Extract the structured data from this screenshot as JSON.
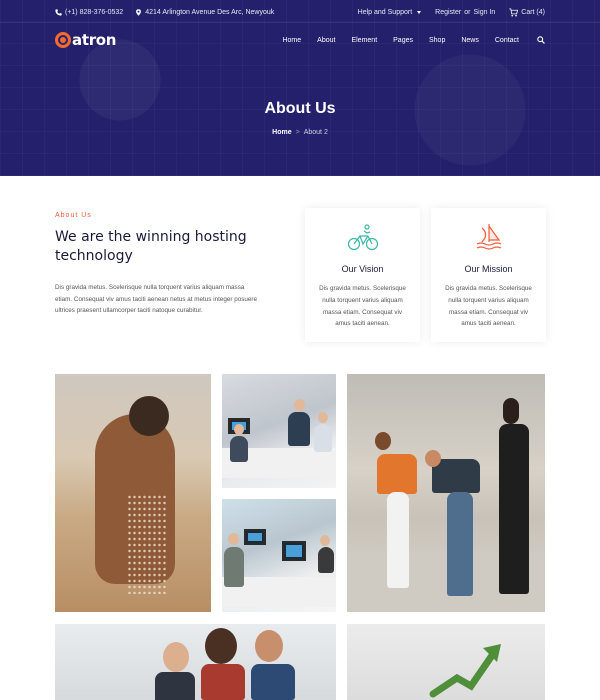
{
  "topbar": {
    "phone": "(+1) 828-376-0532",
    "address": "4214 Arlington Avenue Des Arc, Newyouk",
    "help": "Help and Support",
    "register": "Register",
    "or": "or",
    "signin": "Sign In",
    "cart": "Cart (4)"
  },
  "brand": {
    "logo_text": "atron",
    "accent": "#f56a2e",
    "hero_bg": "#24206b"
  },
  "nav": {
    "items": [
      "Home",
      "About",
      "Element",
      "Pages",
      "Shop",
      "News",
      "Contact"
    ]
  },
  "hero": {
    "title": "About Us",
    "breadcrumb": {
      "home": "Home",
      "separator": ">",
      "current": "About 2"
    }
  },
  "about": {
    "kicker": "About Us",
    "headline_line1": "We are the winning hosting",
    "headline_line2": "technology",
    "text": "Dis gravida metus. Scelerisque nulla torquent varius aliquam massa etiam. Consequat viv amus taciti aenean netus at metus integer posuere ultrices praesent ullamcorper taciti natoque curabitur."
  },
  "cards": [
    {
      "icon": "cyclist-icon",
      "title": "Our Vision",
      "text": "Dis gravida metus. Scelerisque nulla torquent varius aliquam massa etiam. Consequat viv amus taciti aenean."
    },
    {
      "icon": "sailboat-icon",
      "title": "Our Mission",
      "text": "Dis gravida metus. Scelerisque nulla torquent varius aliquam massa etiam. Consequat viv amus taciti aenean."
    }
  ],
  "colors": {
    "kicker": "#f25c3a",
    "icon_vision": "#3bb6a6",
    "icon_mission": "#f25c3a"
  }
}
